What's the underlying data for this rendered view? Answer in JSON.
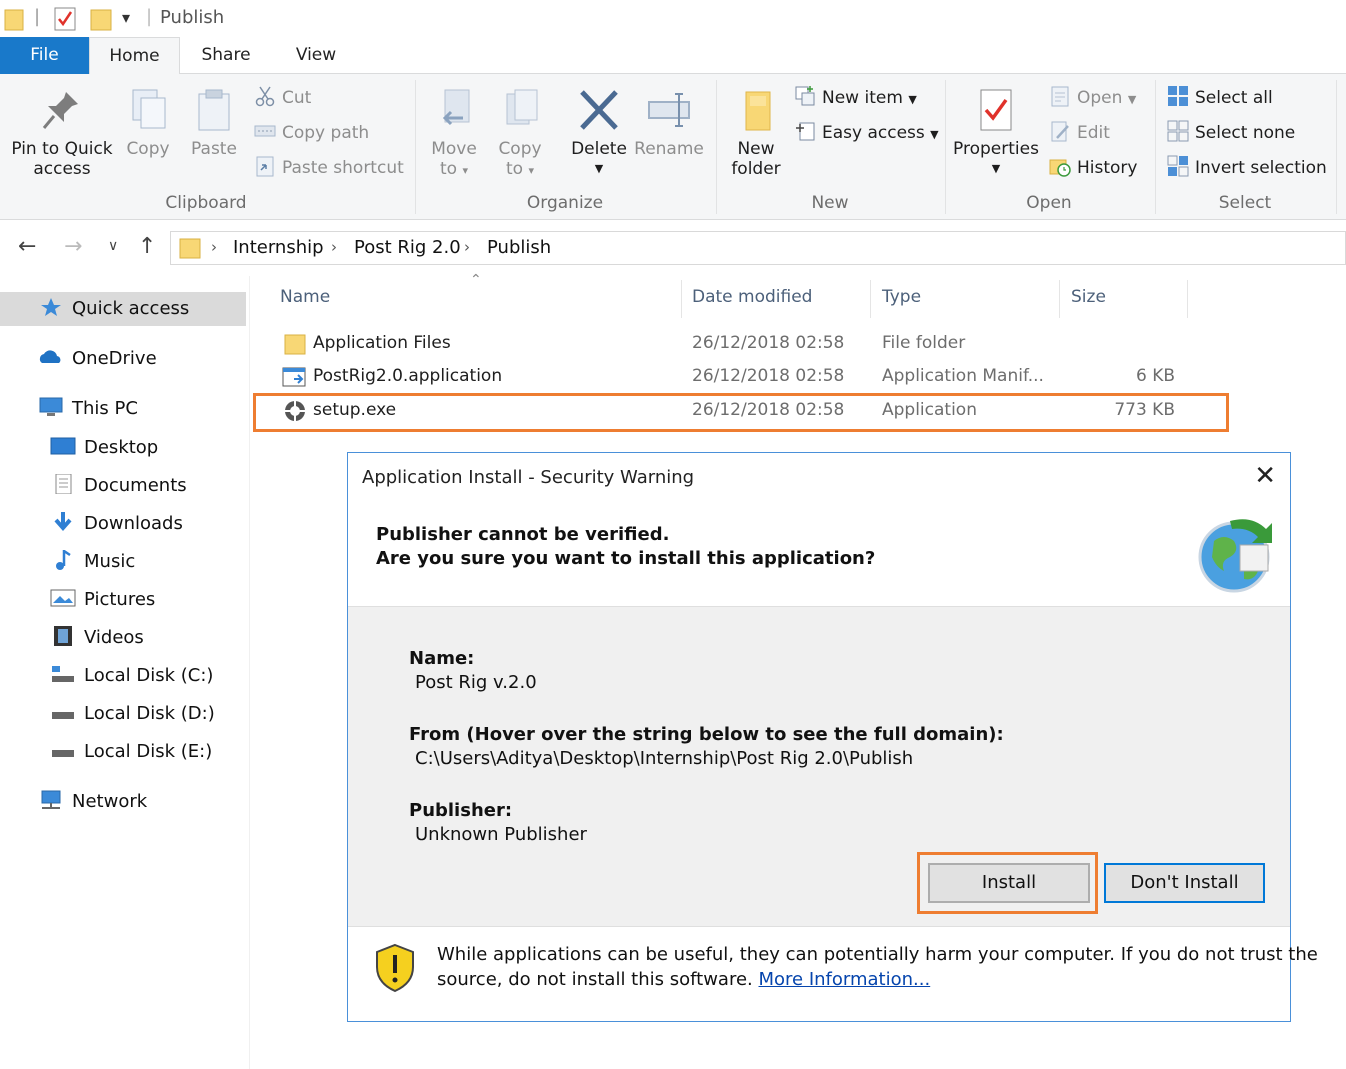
{
  "window": {
    "title": "Publish"
  },
  "tabs": {
    "file": "File",
    "home": "Home",
    "share": "Share",
    "view": "View"
  },
  "ribbon": {
    "clipboard": {
      "label": "Clipboard",
      "pin": [
        "Pin to Quick",
        "access"
      ],
      "copy": "Copy",
      "paste": "Paste",
      "cut": "Cut",
      "copy_path": "Copy path",
      "paste_shortcut": "Paste shortcut"
    },
    "organize": {
      "label": "Organize",
      "move_to": [
        "Move",
        "to"
      ],
      "copy_to": [
        "Copy",
        "to"
      ],
      "delete": "Delete",
      "rename": "Rename"
    },
    "new": {
      "label": "New",
      "new_folder": [
        "New",
        "folder"
      ],
      "new_item": "New item",
      "easy_access": "Easy access"
    },
    "open": {
      "label": "Open",
      "properties": "Properties",
      "open": "Open",
      "edit": "Edit",
      "history": "History"
    },
    "select": {
      "label": "Select",
      "select_all": "Select all",
      "select_none": "Select none",
      "invert": "Invert selection"
    }
  },
  "breadcrumb": [
    "Internship",
    "Post Rig 2.0",
    "Publish"
  ],
  "nav": {
    "quick_access": "Quick access",
    "onedrive": "OneDrive",
    "this_pc": "This PC",
    "desktop": "Desktop",
    "documents": "Documents",
    "downloads": "Downloads",
    "music": "Music",
    "pictures": "Pictures",
    "videos": "Videos",
    "disk_c": "Local Disk (C:)",
    "disk_d": "Local Disk (D:)",
    "disk_e": "Local Disk (E:)",
    "network": "Network"
  },
  "columns": {
    "name": "Name",
    "date": "Date modified",
    "type": "Type",
    "size": "Size"
  },
  "files": [
    {
      "name": "Application Files",
      "date": "26/12/2018 02:58",
      "type": "File folder",
      "size": ""
    },
    {
      "name": "PostRig2.0.application",
      "date": "26/12/2018 02:58",
      "type": "Application Manif...",
      "size": "6 KB"
    },
    {
      "name": "setup.exe",
      "date": "26/12/2018 02:58",
      "type": "Application",
      "size": "773 KB"
    }
  ],
  "dialog": {
    "title": "Application Install - Security Warning",
    "heading1": "Publisher cannot be verified.",
    "heading2": "Are you sure you want to install this application?",
    "name_label": "Name:",
    "name_value": "Post Rig v.2.0",
    "from_label": "From (Hover over the string below to see the full domain):",
    "from_value": "C:\\Users\\Aditya\\Desktop\\Internship\\Post Rig 2.0\\Publish",
    "publisher_label": "Publisher:",
    "publisher_value": "Unknown Publisher",
    "install": "Install",
    "dont_install": "Don't Install",
    "footer_line1": "While applications can be useful, they can potentially harm your computer. If you do not trust the",
    "footer_line2": "source, do not install this software.",
    "more_info": "More Information..."
  },
  "colors": {
    "accent": "#1979ca",
    "highlight": "#ee7d31",
    "folder": "#f8d775"
  }
}
